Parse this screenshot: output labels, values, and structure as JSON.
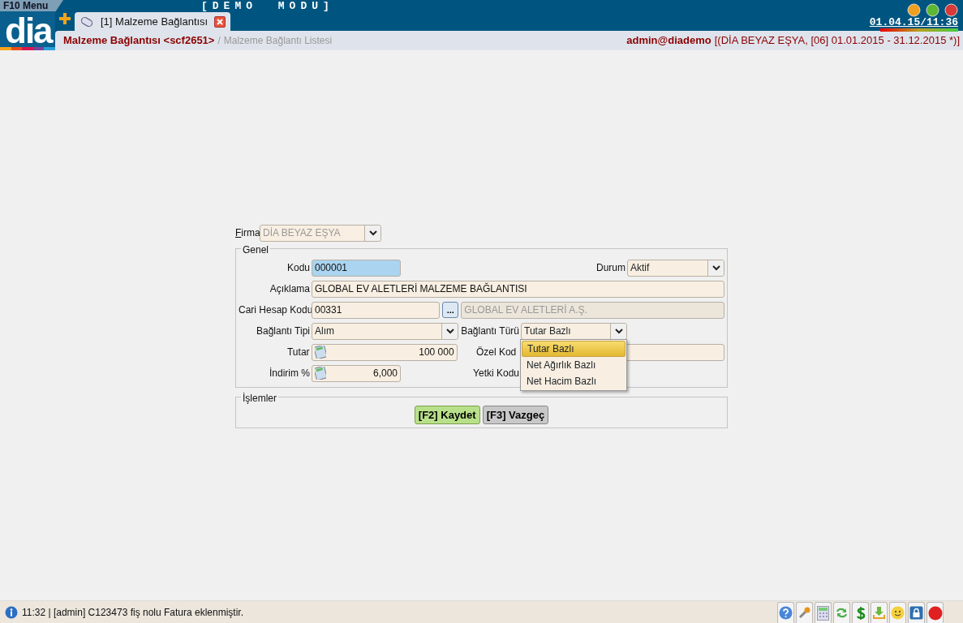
{
  "top_bar": {
    "menu_button": "F10 Menu",
    "mode_banner": "[DEMO MODU]",
    "logo": "dia",
    "tabs": [
      {
        "label": "[1] Malzeme Bağlantısı",
        "selected": true
      }
    ],
    "datetime": "01.04.15/11:36"
  },
  "breadcrumb": {
    "current": "Malzeme Bağlantısı <scf2651>",
    "separator": "/",
    "parent": "Malzeme Bağlantı Listesi"
  },
  "session": {
    "user": "admin@diademo",
    "context": "[(DİA BEYAZ EŞYA, [06] 01.01.2015 - 31.12.2015 *)]"
  },
  "form": {
    "firma": {
      "label": "Firma",
      "value": "DİA BEYAZ EŞYA",
      "disabled": true
    },
    "genel": {
      "legend": "Genel",
      "kodu": {
        "label": "Kodu",
        "value": "000001",
        "focused": true
      },
      "durum": {
        "label": "Durum",
        "value": "Aktif"
      },
      "aciklama": {
        "label": "Açıklama",
        "value": "GLOBAL EV ALETLERİ MALZEME BAĞLANTISI"
      },
      "cari_hesap_kodu": {
        "label": "Cari Hesap Kodu",
        "value": "00331",
        "lookup_button": "...",
        "name_value": "GLOBAL EV ALETLERİ A.Ş.",
        "name_disabled": true
      },
      "baglanti_tipi": {
        "label": "Bağlantı Tipi",
        "value": "Alım"
      },
      "baglanti_turu": {
        "label": "Bağlantı Türü",
        "value": "Tutar Bazlı",
        "expanded": true,
        "options": [
          {
            "label": "Tutar Bazlı",
            "selected": true
          },
          {
            "label": "Net Ağırlık Bazlı",
            "selected": false
          },
          {
            "label": "Net Hacim Bazlı",
            "selected": false
          }
        ]
      },
      "tutar": {
        "label": "Tutar",
        "value": "100 000"
      },
      "ozel_kod": {
        "label": "Özel Kod"
      },
      "indirim": {
        "label": "İndirim %",
        "value": "6,000"
      },
      "yetki_kodu": {
        "label": "Yetki Kodu"
      }
    },
    "islemler": {
      "legend": "İşlemler",
      "buttons": [
        {
          "label": "[F2] Kaydet",
          "kind": "primary"
        },
        {
          "label": "[F3] Vazgeç",
          "kind": "secondary"
        }
      ]
    }
  },
  "status_bar": {
    "message": "11:32 | [admin] C123473 fiş nolu Fatura eklenmiştir."
  }
}
